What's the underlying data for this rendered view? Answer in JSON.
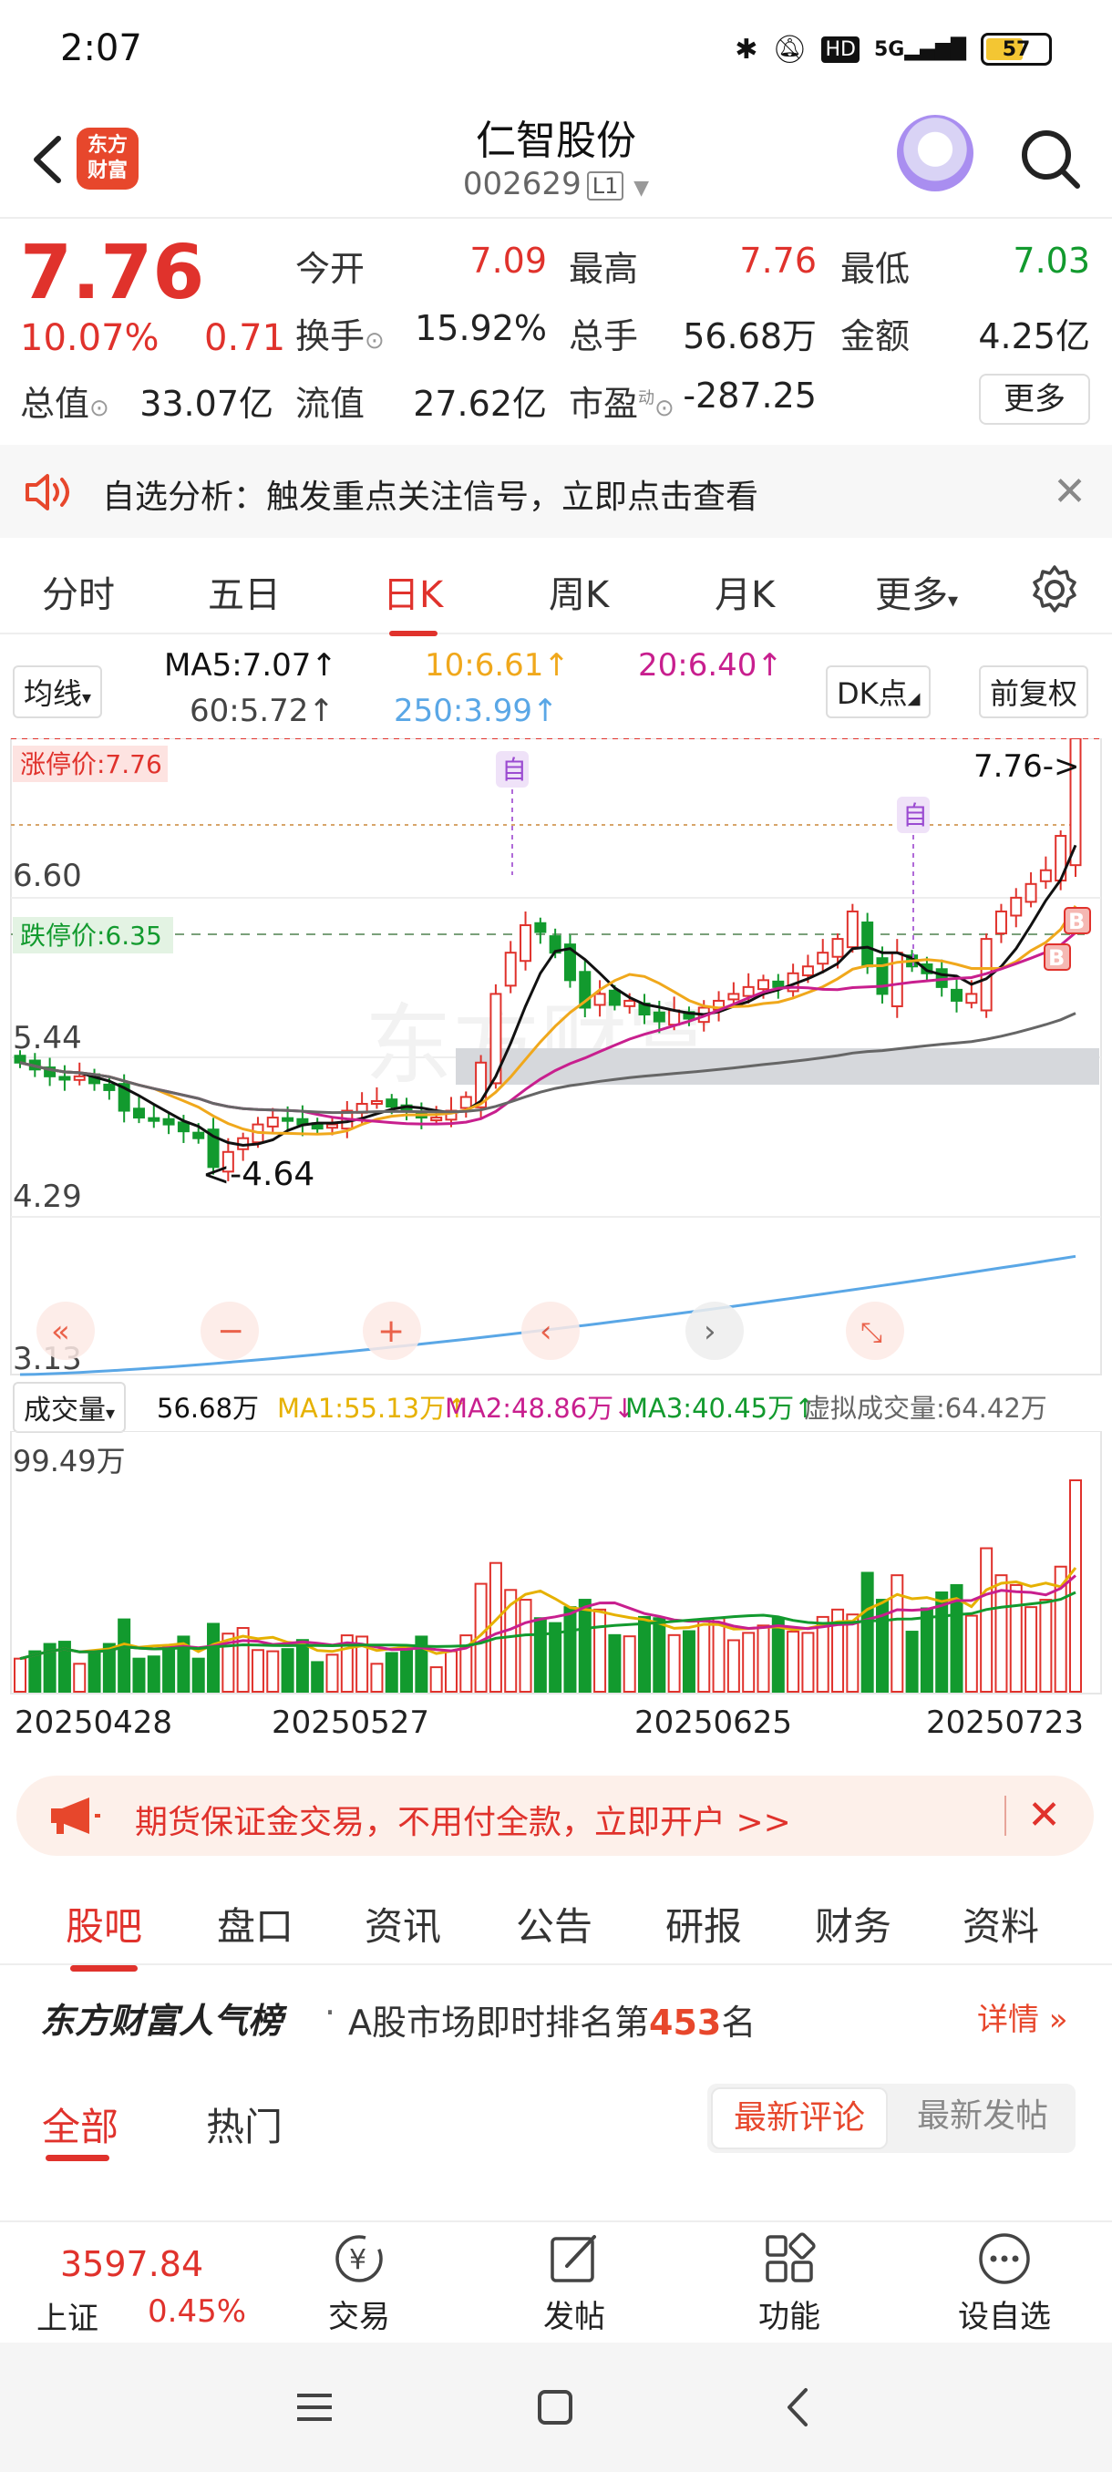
{
  "status_bar": {
    "time": "2:07",
    "hd_label": "HD",
    "net_label": "5G",
    "battery": "57"
  },
  "header": {
    "logo_text_1": "东方",
    "logo_text_2": "财富",
    "stock_name": "仁智股份",
    "stock_code": "002629",
    "level": "L1"
  },
  "quote": {
    "price": "7.76",
    "change_pct": "10.07%",
    "change": "0.71",
    "open_label": "今开",
    "open": "7.09",
    "high_label": "最高",
    "high": "7.76",
    "low_label": "最低",
    "low": "7.03",
    "turnover_label": "换手",
    "turnover": "15.92%",
    "volume_label": "总手",
    "volume": "56.68万",
    "amount_label": "金额",
    "amount": "4.25亿",
    "mktcap_label": "总值",
    "mktcap": "33.07亿",
    "float_label": "流值",
    "float_cap": "27.62亿",
    "pe_label": "市盈",
    "pe_sup": "动",
    "pe": "-287.25",
    "more": "更多"
  },
  "notice": {
    "text": "自选分析：触发重点关注信号，立即点击查看"
  },
  "period_tabs": [
    {
      "label": "分时"
    },
    {
      "label": "五日"
    },
    {
      "label": "日K"
    },
    {
      "label": "周K"
    },
    {
      "label": "月K"
    },
    {
      "label": "更多"
    }
  ],
  "ma_legend": {
    "selector": "均线",
    "ma5": "MA5:7.07↑",
    "ma10": "10:6.61↑",
    "ma20": "20:6.40↑",
    "ma60": "60:5.72↑",
    "ma250": "250:3.99↑",
    "dk": "DK点",
    "adjust": "前复权"
  },
  "chart_data": {
    "type": "candlestick",
    "y_ticks": [
      "7.76",
      "6.60",
      "5.44",
      "4.29",
      "3.13"
    ],
    "limit_up_label": "涨停价:7.76",
    "limit_down_label": "跌停价:6.35",
    "current_label": "7.76->",
    "low_label": "<-4.64",
    "marker_self": "自",
    "marker_buy": "B",
    "watermark": "东方财富",
    "ylim": [
      3.13,
      7.76
    ],
    "closes": [
      5.4,
      5.35,
      5.3,
      5.28,
      5.3,
      5.25,
      5.2,
      5.05,
      5.0,
      4.98,
      4.95,
      4.9,
      4.85,
      4.64,
      4.75,
      4.85,
      4.95,
      5.0,
      4.98,
      4.95,
      4.92,
      4.95,
      5.05,
      5.1,
      5.12,
      5.08,
      5.05,
      5.0,
      5.0,
      5.05,
      5.15,
      5.4,
      5.9,
      6.2,
      6.4,
      6.35,
      6.2,
      6.0,
      5.8,
      5.9,
      5.82,
      5.85,
      5.75,
      5.7,
      5.78,
      5.72,
      5.8,
      5.85,
      5.9,
      5.95,
      6.0,
      5.95,
      6.05,
      6.1,
      6.2,
      6.3,
      6.5,
      6.1,
      5.9,
      6.2,
      6.1,
      6.05,
      5.95,
      5.85,
      5.9,
      6.3,
      6.5,
      6.6,
      6.7,
      6.8,
      7.05,
      7.76
    ],
    "volume": {
      "legend_label": "成交量",
      "value": "56.68万",
      "ma1": "MA1:55.13万↑",
      "ma2": "MA2:48.86万↓",
      "ma3": "MA3:40.45万↑",
      "virtual": "虚拟成交量:64.42万",
      "max_label": "99.49万"
    },
    "dates": [
      "20250428",
      "20250527",
      "20250625",
      "20250723"
    ]
  },
  "promo": {
    "text": "期货保证金交易，不用付全款，立即开户 >>"
  },
  "section_tabs": [
    {
      "label": "股吧"
    },
    {
      "label": "盘口"
    },
    {
      "label": "资讯"
    },
    {
      "label": "公告"
    },
    {
      "label": "研报"
    },
    {
      "label": "财务"
    },
    {
      "label": "资料"
    }
  ],
  "rank": {
    "brand": "东方财富人气榜",
    "dot": "·",
    "prefix": "A股市场即时排名第",
    "number": "453",
    "suffix": "名",
    "detail": "详情"
  },
  "filters": {
    "all": "全部",
    "hot": "热门",
    "latest_comment": "最新评论",
    "latest_post": "最新发帖"
  },
  "bottom_nav": {
    "index_value": "3597.84",
    "index_name": "上证",
    "index_pct": "0.45%",
    "trade": "交易",
    "post": "发帖",
    "function": "功能",
    "add_watch": "设自选"
  },
  "colors": {
    "up": "#e0322c",
    "down": "#129a2e",
    "ma5": "#111111",
    "ma10": "#f0a81c",
    "ma20": "#c81f8e",
    "ma60": "#666666",
    "ma250": "#5aa7e6"
  }
}
